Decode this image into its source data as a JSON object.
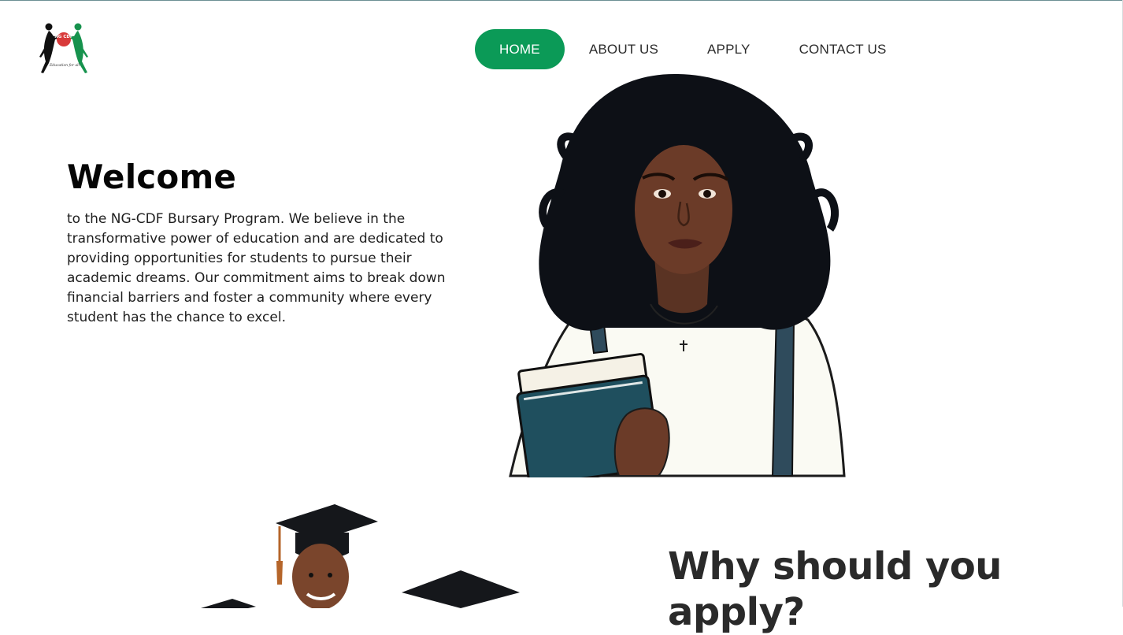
{
  "colors": {
    "accent": "#0b9a57",
    "text": "#2b2b2b",
    "dark": "#050505"
  },
  "logo": {
    "icon": "ngcdf-logo-icon",
    "badge_text": "NG CDF",
    "tagline": "Education for all"
  },
  "nav": {
    "items": [
      {
        "label": "HOME",
        "active": true
      },
      {
        "label": "ABOUT US",
        "active": false
      },
      {
        "label": "APPLY",
        "active": false
      },
      {
        "label": "CONTACT US",
        "active": false
      }
    ]
  },
  "hero": {
    "title": "Welcome",
    "text": "to the NG-CDF Bursary Program. We believe in the transformative power of education and are dedicated to providing opportunities for students to pursue their academic dreams. Our commitment aims to break down financial barriers and foster a community where every student has the chance to excel."
  },
  "section2": {
    "title": "Why should you apply?"
  }
}
